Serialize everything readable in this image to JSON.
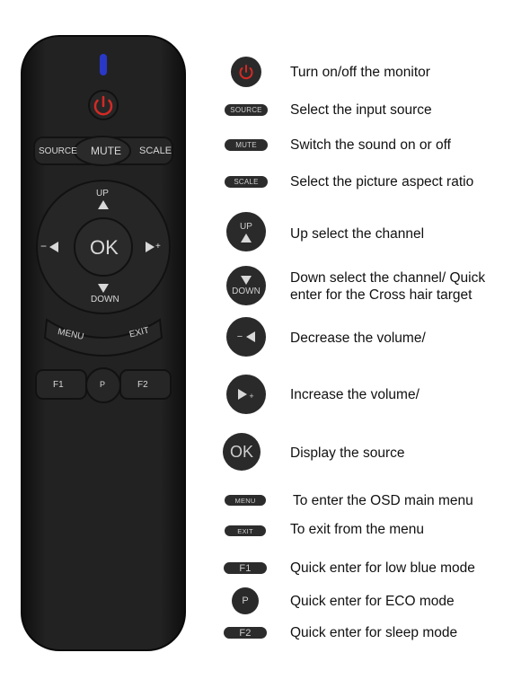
{
  "remote": {
    "source_label": "SOURCE",
    "mute_label": "MUTE",
    "scale_label": "SCALE",
    "up_label": "UP",
    "down_label": "DOWN",
    "ok_label": "OK",
    "minus_label": "−",
    "plus_label": "+",
    "menu_label": "MENU",
    "exit_label": "EXIT",
    "f1_label": "F1",
    "p_label": "P",
    "f2_label": "F2"
  },
  "legend": [
    {
      "key": "power",
      "icon": "power-icon",
      "desc": "Turn on/off the monitor"
    },
    {
      "key": "source",
      "icon_text": "SOURCE",
      "desc": "Select the input source"
    },
    {
      "key": "mute",
      "icon_text": "MUTE",
      "desc": "Switch the sound on or off"
    },
    {
      "key": "scale",
      "icon_text": "SCALE",
      "desc": "Select the picture aspect ratio"
    },
    {
      "key": "up",
      "icon_text": "UP",
      "desc": "Up select the channel"
    },
    {
      "key": "down",
      "icon_text": "DOWN",
      "desc_line1": "Down select the channel/ Quick",
      "desc_line2": "enter for the Cross hair target"
    },
    {
      "key": "vol-down",
      "icon_text": "−",
      "desc": "Decrease the volume/"
    },
    {
      "key": "vol-up",
      "icon_text": "+",
      "desc": "Increase the volume/"
    },
    {
      "key": "ok",
      "icon_text": "OK",
      "desc": "Display the source"
    },
    {
      "key": "menu",
      "icon_text": "MENU",
      "desc": "To enter the OSD main menu"
    },
    {
      "key": "exit",
      "icon_text": "EXIT",
      "desc": "To exit from the menu"
    },
    {
      "key": "f1",
      "icon_text": "F1",
      "desc": "Quick enter for low blue mode"
    },
    {
      "key": "p",
      "icon_text": "P",
      "desc": "Quick enter for ECO mode"
    },
    {
      "key": "f2",
      "icon_text": "F2",
      "desc": "Quick enter for sleep mode"
    }
  ],
  "colors": {
    "remote_body": "#1c1c1c",
    "button_face": "#262626",
    "power_red": "#d42a25",
    "indicator_blue": "#2a38c8"
  }
}
